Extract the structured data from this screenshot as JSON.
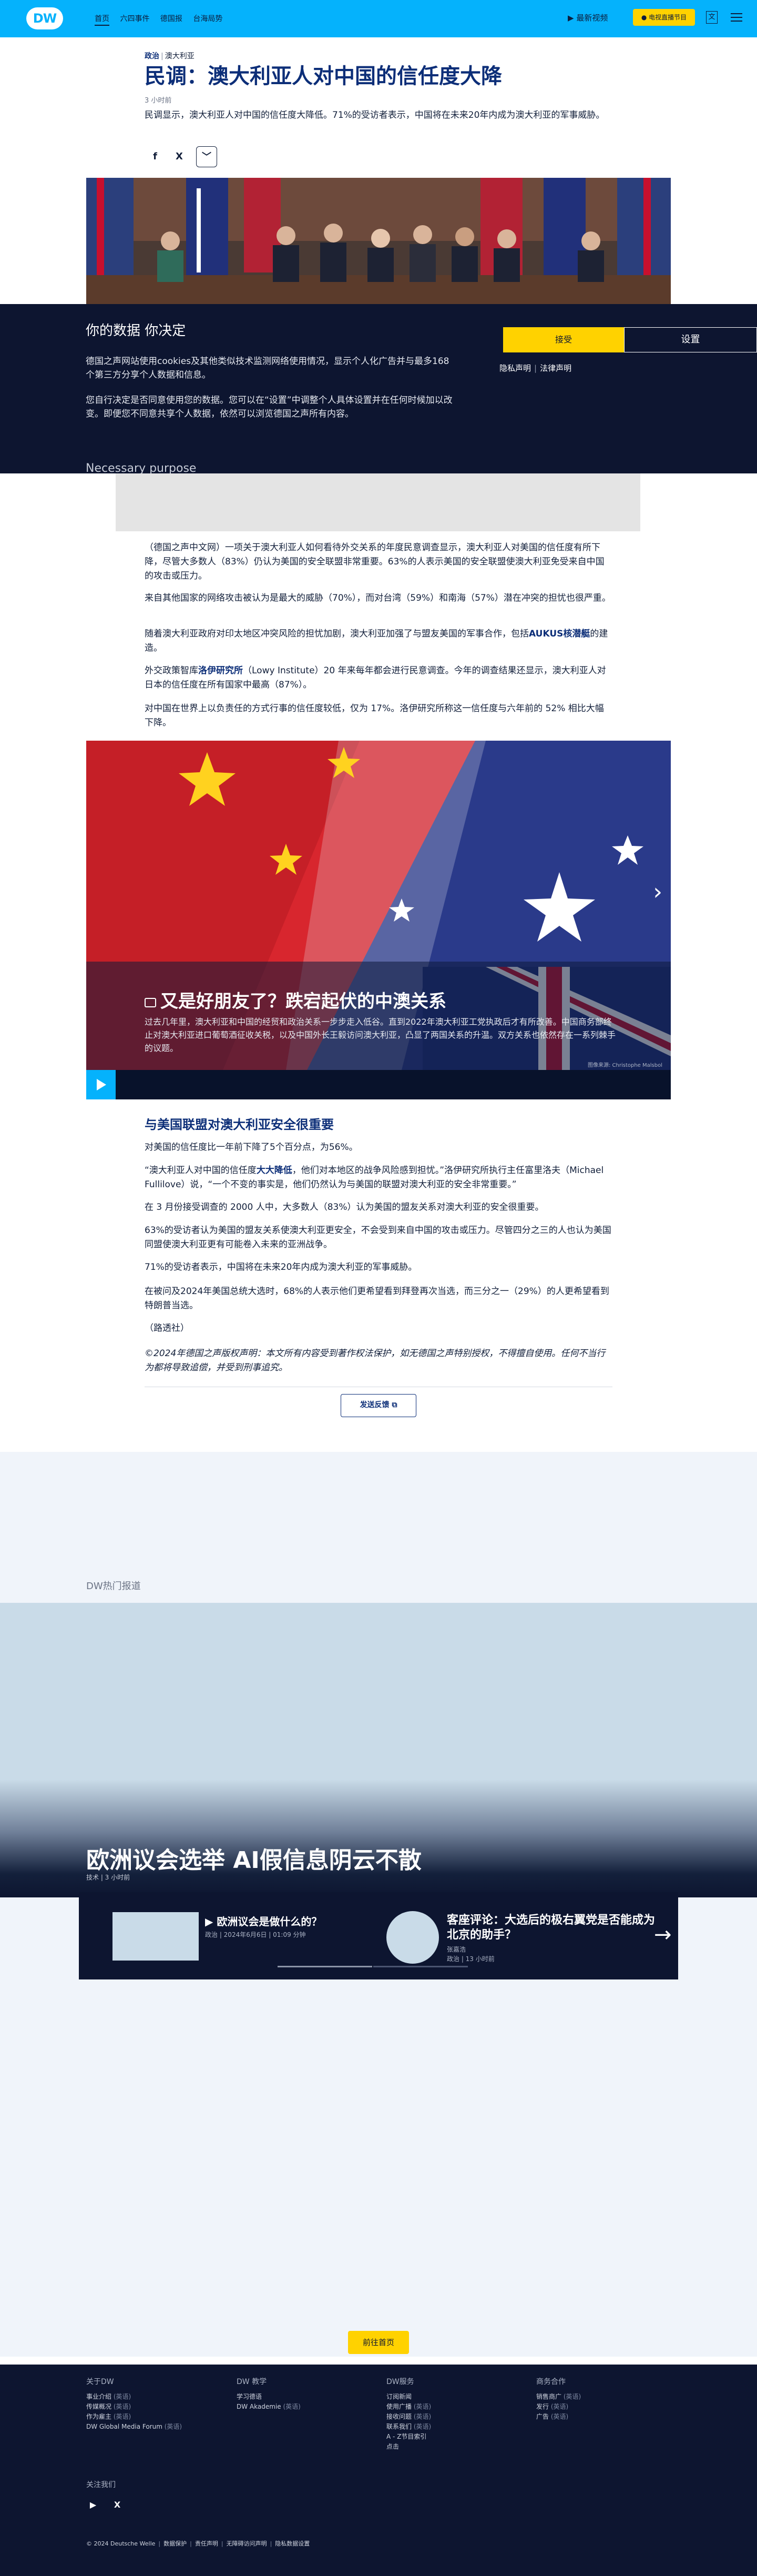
{
  "header": {
    "logo": "DW",
    "nav": [
      "首页",
      "六四事件",
      "德国报",
      "台海局势"
    ],
    "latest_videos": "最新视频",
    "live_button": "● 电视直播节目",
    "lang_label": "文"
  },
  "article": {
    "category": "政治",
    "region": "澳大利亚",
    "title": "民调：澳大利亚人对中国的信任度大降",
    "updated": "3 小时前",
    "lead": "民调显示，澳大利亚人对中国的信任度大降低。71%的受访者表示，中国将在未来20年内成为澳大利亚的军事威胁。",
    "share": [
      "f",
      "X",
      "﹀"
    ]
  },
  "cookie": {
    "title": "你的数据 你决定",
    "p1": "德国之声网站使用cookies及其他类似技术监测网络使用情况，显示个人化广告并与最多168 个第三方分享个人数据和信息。",
    "p2": "您自行决定是否同意使用您的数据。您可以在“设置”中调整个人具体设置并在任何时候加以改变。即便您不同意共享个人数据，依然可以浏览德国之声所有内容。",
    "necessary": "Necessary purpose",
    "accept": "接受",
    "settings": "设置",
    "privacy": "隐私声明",
    "legal": "法律声明"
  },
  "body": {
    "p1": "（德国之声中文网）一项关于澳大利亚人如何看待外交关系的年度民意调查显示，澳大利亚人对美国的信任度有所下降，尽管大多数人（83%）仍认为美国的安全联盟非常重要。63%的人表示美国的安全联盟使澳大利亚免受来自中国的攻击或压力。",
    "p2": "来自其他国家的网络攻击被认为是最大的威胁（70%），而对台湾（59%）和南海（57%）潜在冲突的担忧也很严重。",
    "p3_a": "随着澳大利亚政府对印太地区冲突风险的担忧加剧，澳大利亚加强了与盟友美国的军事合作，包括",
    "p3_link": "AUKUS核潜艇",
    "p3_b": "的建造。",
    "p4_a": "外交政策智库",
    "p4_link": "洛伊研究所",
    "p4_b": "（Lowy Institute）20 年来每年都会进行民意调查。今年的调查结果还显示，澳大利亚人对日本的信任度在所有国家中最高（87%）。",
    "p5": "对中国在世界上以负责任的方式行事的信任度较低，仅为 17%。洛伊研究所称这一信任度与六年前的 52% 相比大幅下降。"
  },
  "gallery": {
    "title": "又是好朋友了？跌宕起伏的中澳关系",
    "desc": "过去几年里，澳大利亚和中国的经贸和政治关系一步步走入低谷。直到2022年澳大利亚工党执政后才有所改善。中国商务部终止对澳大利亚进口葡萄酒征收关税，以及中国外长王毅访问澳大利亚，凸显了两国关系的升温。双方关系也依然存在一系列棘手的议题。",
    "credit": "图像来源: Christophe Malsbol"
  },
  "section2": {
    "heading": "与美国联盟对澳大利亚安全很重要",
    "p1": "对美国的信任度比一年前下降了5个百分点，为56%。",
    "p2_a": "“澳大利亚人对中国的信任度",
    "p2_link": "大大降低",
    "p2_b": "，他们对本地区的战争风险感到担忧。”洛伊研究所执行主任富里洛夫（Michael Fullilove）说，“一个不变的事实是，他们仍然认为与美国的联盟对澳大利亚的安全非常重要。”",
    "p3": "在 3 月份接受调查的 2000 人中，大多数人（83%）认为美国的盟友关系对澳大利亚的安全很重要。",
    "p4": "63%的受访者认为美国的盟友关系使澳大利亚更安全，不会受到来自中国的攻击或压力。尽管四分之三的人也认为美国同盟使澳大利亚更有可能卷入未来的亚洲战争。",
    "p5": "71%的受访者表示，中国将在未来20年内成为澳大利亚的军事威胁。",
    "p6": "在被问及2024年美国总统大选时，68%的人表示他们更希望看到拜登再次当选，而三分之一（29%）的人更希望看到特朗普当选。",
    "source": "（路透社）",
    "copyright": "©2024年德国之声版权声明：本文所有内容受到著作权法保护，如无德国之声特别授权，不得擅自使用。任何不当行为都将导致追偿，并受到刑事追究。",
    "feedback": "发送反馈"
  },
  "lower": {
    "hot_label": "DW热门报道",
    "teaser_title": "欧洲议会选举 AI假信息阴云不散",
    "teaser_meta": "技术 | 3 小时前",
    "item1_title": "欧洲议会是做什么的？",
    "item1_meta": "政治 | 2024年6月6日 | 01:09 分钟",
    "item2_title": "客座评论：大选后的极右翼党是否能成为北京的助手？",
    "item2_author": "张嘉浩",
    "item2_meta": "政治 | 13 小时前",
    "home_button": "前往首页"
  },
  "footer": {
    "col1_title": "关于DW",
    "col1": [
      [
        "事业介绍",
        "(英语)"
      ],
      [
        "传媒概况",
        "(英语)"
      ],
      [
        "作为雇主",
        "(英语)"
      ],
      [
        "DW Global Media Forum",
        "(英语)"
      ]
    ],
    "col2_title": "DW 教学",
    "col2": [
      [
        "学习德语",
        ""
      ],
      [
        "DW Akademie",
        "(英语)"
      ]
    ],
    "col3_title": "DW服务",
    "col3": [
      [
        "订阅新闻",
        ""
      ],
      [
        "使用广播",
        "(英语)"
      ],
      [
        "接收问题",
        "(英语)"
      ],
      [
        "联系我们",
        "(英语)"
      ],
      [
        "A - Z节目索引",
        ""
      ],
      [
        "点击",
        ""
      ]
    ],
    "col4_title": "商务合作",
    "col4": [
      [
        "销售商广",
        "(英语)"
      ],
      [
        "发行",
        "(英语)"
      ],
      [
        "广告",
        "(英语)"
      ]
    ],
    "follow": "关注我们",
    "bottom": [
      "© 2024 Deutsche Welle",
      "数据保护",
      "责任声明",
      "无障碍访问声明",
      "隐私数据设置"
    ]
  }
}
